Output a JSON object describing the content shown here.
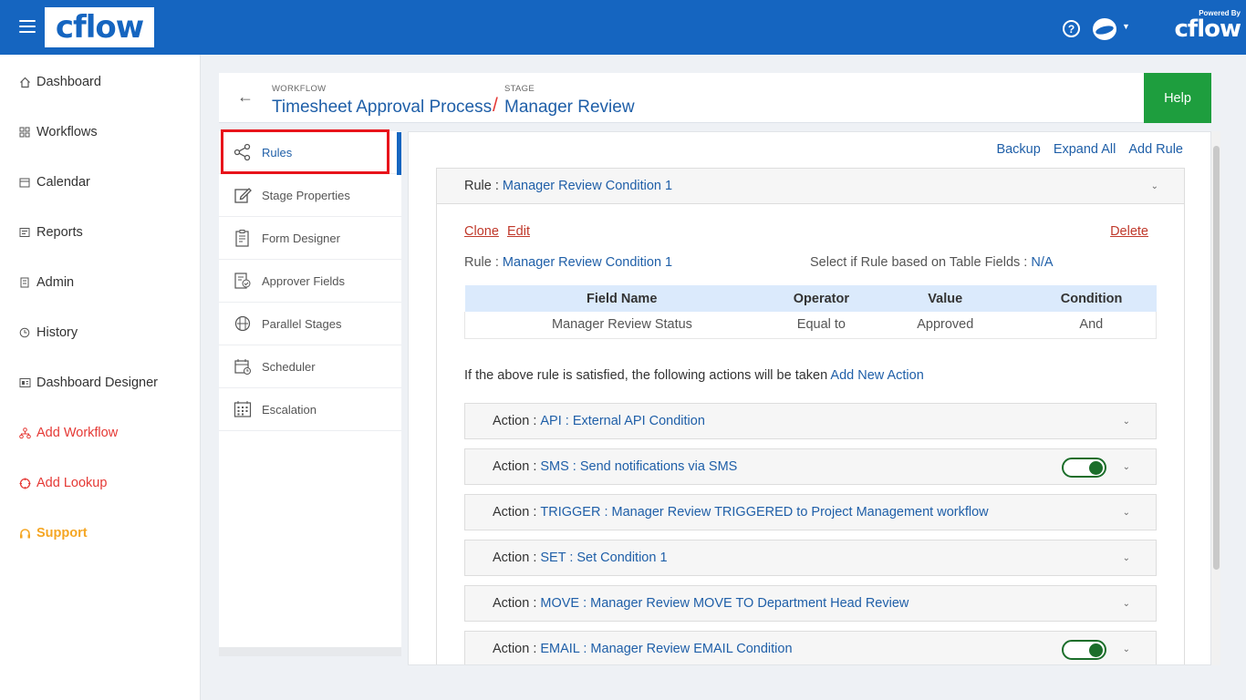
{
  "brand": {
    "logo_text": "cflow",
    "powered_by": "Powered By",
    "powered_logo": "cflow"
  },
  "topbar": {
    "help_icon_glyph": "?"
  },
  "sidebar": {
    "items": [
      {
        "label": "Dashboard",
        "icon": "home-icon"
      },
      {
        "label": "Workflows",
        "icon": "grid-icon"
      },
      {
        "label": "Calendar",
        "icon": "calendar-icon"
      },
      {
        "label": "Reports",
        "icon": "report-icon"
      },
      {
        "label": "Admin",
        "icon": "admin-icon"
      },
      {
        "label": "History",
        "icon": "history-icon"
      },
      {
        "label": "Dashboard Designer",
        "icon": "dashboard-designer-icon"
      },
      {
        "label": "Add Workflow",
        "icon": "add-workflow-icon"
      },
      {
        "label": "Add Lookup",
        "icon": "add-lookup-icon"
      },
      {
        "label": "Support",
        "icon": "headset-icon"
      }
    ]
  },
  "header": {
    "workflow_label": "WORKFLOW",
    "workflow_value": "Timesheet Approval Process",
    "separator": "/",
    "stage_label": "STAGE",
    "stage_value": "Manager Review",
    "help_label": "Help"
  },
  "stage_menu": {
    "items": [
      {
        "label": "Rules",
        "icon": "share-icon"
      },
      {
        "label": "Stage Properties",
        "icon": "edit-icon"
      },
      {
        "label": "Form Designer",
        "icon": "form-icon"
      },
      {
        "label": "Approver Fields",
        "icon": "approver-icon"
      },
      {
        "label": "Parallel Stages",
        "icon": "parallel-icon"
      },
      {
        "label": "Scheduler",
        "icon": "scheduler-icon"
      },
      {
        "label": "Escalation",
        "icon": "escalation-icon"
      }
    ]
  },
  "rules": {
    "top_links": {
      "backup": "Backup",
      "expand_all": "Expand All",
      "add_rule": "Add Rule"
    },
    "rule_prefix": "Rule :",
    "rule_name": "Manager Review Condition 1",
    "clone": "Clone",
    "edit": "Edit",
    "delete": "Delete",
    "table_fields_label": "Select if Rule based on Table Fields :",
    "table_fields_value": "N/A",
    "table": {
      "headers": [
        "Field Name",
        "Operator",
        "Value",
        "Condition"
      ],
      "rows": [
        [
          "Manager Review Status",
          "Equal to",
          "Approved",
          "And"
        ]
      ]
    },
    "actions_intro": "If the above rule is satisfied, the following actions will be taken",
    "add_new_action": "Add New Action",
    "action_prefix": "Action :",
    "actions": [
      {
        "value": "API : External API Condition",
        "toggle": false
      },
      {
        "value": "SMS : Send notifications via SMS",
        "toggle": true
      },
      {
        "value": "TRIGGER : Manager Review TRIGGERED to Project Management workflow",
        "toggle": false
      },
      {
        "value": "SET : Set Condition 1",
        "toggle": false
      },
      {
        "value": "MOVE : Manager Review MOVE TO Department Head Review",
        "toggle": false
      },
      {
        "value": "EMAIL : Manager Review EMAIL Condition",
        "toggle": true
      }
    ]
  },
  "colors": {
    "primary": "#1565c0",
    "help_green": "#1e9e3e",
    "highlight_red": "#e8141b",
    "toggle_green": "#1b6e2a"
  }
}
